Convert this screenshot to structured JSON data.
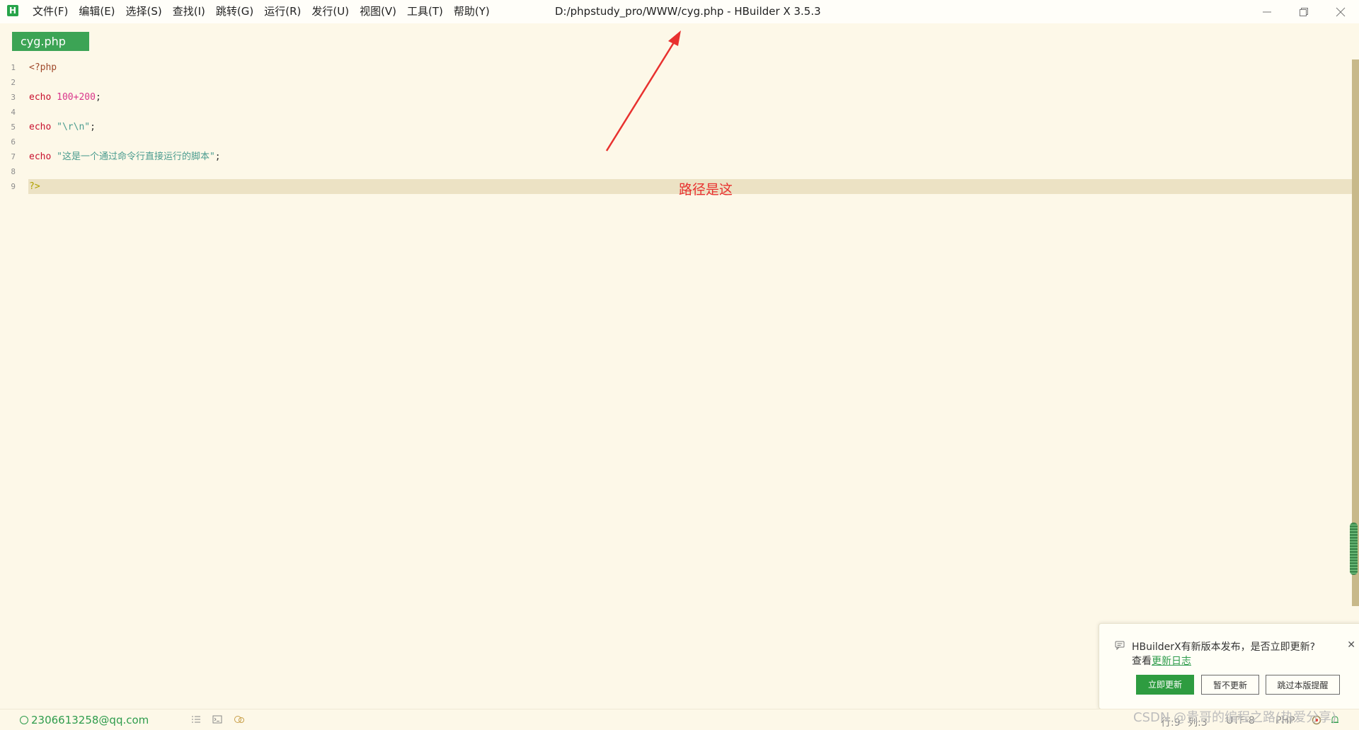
{
  "app": {
    "logo_letter": "H",
    "window_title": "D:/phpstudy_pro/WWW/cyg.php - HBuilder X 3.5.3"
  },
  "menu": [
    {
      "label": "文件(F)"
    },
    {
      "label": "编辑(E)"
    },
    {
      "label": "选择(S)"
    },
    {
      "label": "查找(I)"
    },
    {
      "label": "跳转(G)"
    },
    {
      "label": "运行(R)"
    },
    {
      "label": "发行(U)"
    },
    {
      "label": "视图(V)"
    },
    {
      "label": "工具(T)"
    },
    {
      "label": "帮助(Y)"
    }
  ],
  "tab": {
    "label": "cyg.php"
  },
  "editor": {
    "line_numbers": [
      "1",
      "2",
      "3",
      "4",
      "5",
      "6",
      "7",
      "8",
      "9"
    ],
    "line1": {
      "php_open": "<?php"
    },
    "line3": {
      "kw": "echo",
      "num": "100+200",
      "tail": ";"
    },
    "line5": {
      "kw": "echo",
      "str": "\"\\r\\n\"",
      "tail": ";"
    },
    "line7": {
      "kw": "echo",
      "str": "\"这是一个通过命令行直接运行的脚本\"",
      "tail": ";"
    },
    "line9": {
      "php_close": "?>"
    }
  },
  "annotation": {
    "text": "路径是这",
    "color": "#e8312f"
  },
  "notification": {
    "message": "HBuilderX有新版本发布，是否立即更新?",
    "line2_prefix": "查看",
    "link": "更新日志",
    "buttons": {
      "update_now": "立即更新",
      "later": "暂不更新",
      "skip": "跳过本版提醒"
    }
  },
  "status": {
    "user": "2306613258@qq.com",
    "row": "行:9",
    "col": "列:3",
    "encoding": "UTF-8",
    "language": "PHP"
  },
  "watermark": "CSDN @贵哥的编程之路(热爱分享)",
  "colors": {
    "accent": "#3ca455",
    "editor_bg": "#fdf8e8",
    "active_line": "#ece2c4"
  }
}
